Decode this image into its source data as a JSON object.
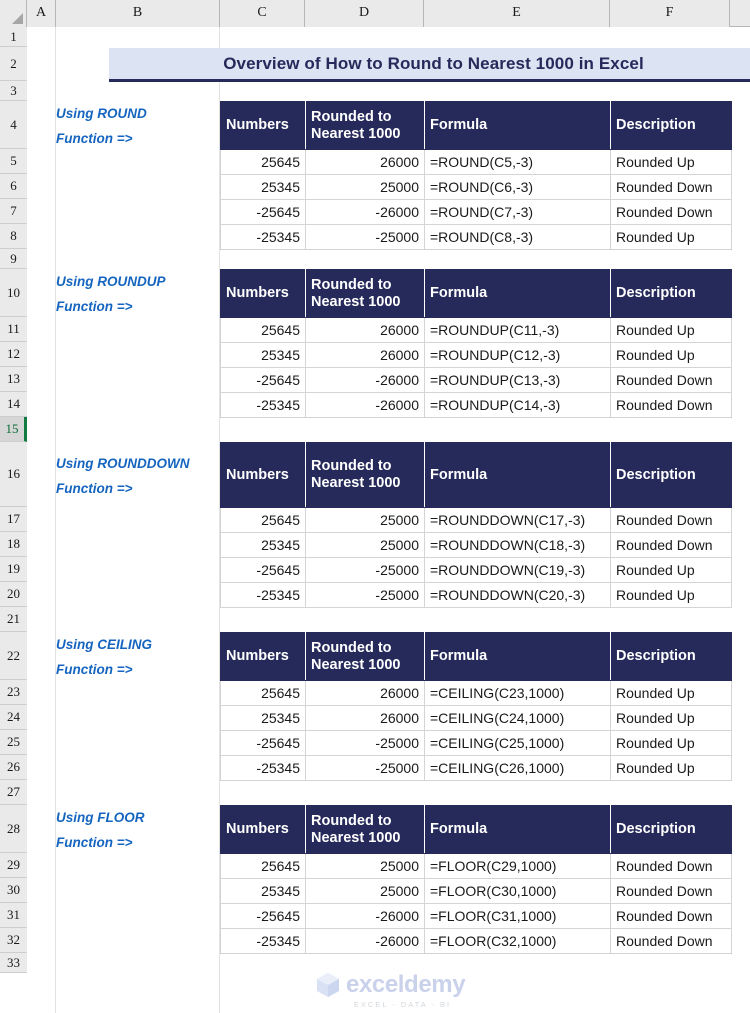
{
  "app": {
    "type": "spreadsheet",
    "colors": {
      "header_navy": "#262A5B",
      "title_fill": "#DCE3F2",
      "label_blue": "#1565C0",
      "selection_green": "#107C41",
      "grid_line": "#D4D4D4"
    }
  },
  "grid": {
    "column_headers": [
      "A",
      "B",
      "C",
      "D",
      "E",
      "F"
    ],
    "row_headers": [
      "1",
      "2",
      "3",
      "4",
      "5",
      "6",
      "7",
      "8",
      "9",
      "10",
      "11",
      "12",
      "13",
      "14",
      "15",
      "16",
      "17",
      "18",
      "19",
      "20",
      "21",
      "22",
      "23",
      "24",
      "25",
      "26",
      "27",
      "28",
      "29",
      "30",
      "31",
      "32",
      "33"
    ],
    "selected_row": "15"
  },
  "title": {
    "text": "Overview of How to Round to Nearest 1000 in Excel"
  },
  "table_headers": {
    "numbers": "Numbers",
    "rounded": "Rounded to Nearest 1000",
    "rounded_line1": "Rounded to",
    "rounded_line2": "Nearest 1000",
    "formula": "Formula",
    "description": "Description"
  },
  "sections": [
    {
      "label_line1": "Using ROUND",
      "label_line2": "Function =>",
      "rows": [
        {
          "number": "25645",
          "rounded": "26000",
          "formula": "=ROUND(C5,-3)",
          "description": "Rounded Up"
        },
        {
          "number": "25345",
          "rounded": "25000",
          "formula": "=ROUND(C6,-3)",
          "description": "Rounded Down"
        },
        {
          "number": "-25645",
          "rounded": "-26000",
          "formula": "=ROUND(C7,-3)",
          "description": "Rounded Down"
        },
        {
          "number": "-25345",
          "rounded": "-25000",
          "formula": "=ROUND(C8,-3)",
          "description": "Rounded Up"
        }
      ]
    },
    {
      "label_line1": "Using ROUNDUP",
      "label_line2": "Function =>",
      "rows": [
        {
          "number": "25645",
          "rounded": "26000",
          "formula": "=ROUNDUP(C11,-3)",
          "description": "Rounded Up"
        },
        {
          "number": "25345",
          "rounded": "26000",
          "formula": "=ROUNDUP(C12,-3)",
          "description": "Rounded Up"
        },
        {
          "number": "-25645",
          "rounded": "-26000",
          "formula": "=ROUNDUP(C13,-3)",
          "description": "Rounded Down"
        },
        {
          "number": "-25345",
          "rounded": "-26000",
          "formula": "=ROUNDUP(C14,-3)",
          "description": "Rounded Down"
        }
      ]
    },
    {
      "label_line1": "Using ROUNDDOWN",
      "label_line2": "Function =>",
      "rows": [
        {
          "number": "25645",
          "rounded": "25000",
          "formula": "=ROUNDDOWN(C17,-3)",
          "description": "Rounded Down"
        },
        {
          "number": "25345",
          "rounded": "25000",
          "formula": "=ROUNDDOWN(C18,-3)",
          "description": "Rounded Down"
        },
        {
          "number": "-25645",
          "rounded": "-25000",
          "formula": "=ROUNDDOWN(C19,-3)",
          "description": "Rounded Up"
        },
        {
          "number": "-25345",
          "rounded": "-25000",
          "formula": "=ROUNDDOWN(C20,-3)",
          "description": "Rounded Up"
        }
      ]
    },
    {
      "label_line1": "Using CEILING",
      "label_line2": "Function =>",
      "rows": [
        {
          "number": "25645",
          "rounded": "26000",
          "formula": "=CEILING(C23,1000)",
          "description": "Rounded Up"
        },
        {
          "number": "25345",
          "rounded": "26000",
          "formula": "=CEILING(C24,1000)",
          "description": "Rounded Up"
        },
        {
          "number": "-25645",
          "rounded": "-25000",
          "formula": "=CEILING(C25,1000)",
          "description": "Rounded Up"
        },
        {
          "number": "-25345",
          "rounded": "-25000",
          "formula": "=CEILING(C26,1000)",
          "description": "Rounded Up"
        }
      ]
    },
    {
      "label_line1": "Using FLOOR",
      "label_line2": "Function =>",
      "rows": [
        {
          "number": "25645",
          "rounded": "25000",
          "formula": "=FLOOR(C29,1000)",
          "description": "Rounded Down"
        },
        {
          "number": "25345",
          "rounded": "25000",
          "formula": "=FLOOR(C30,1000)",
          "description": "Rounded Down"
        },
        {
          "number": "-25645",
          "rounded": "-26000",
          "formula": "=FLOOR(C31,1000)",
          "description": "Rounded Down"
        },
        {
          "number": "-25345",
          "rounded": "-26000",
          "formula": "=FLOOR(C32,1000)",
          "description": "Rounded Down"
        }
      ]
    }
  ],
  "watermark": {
    "word": "exceldemy",
    "subtitle": "EXCEL - DATA - BI"
  }
}
